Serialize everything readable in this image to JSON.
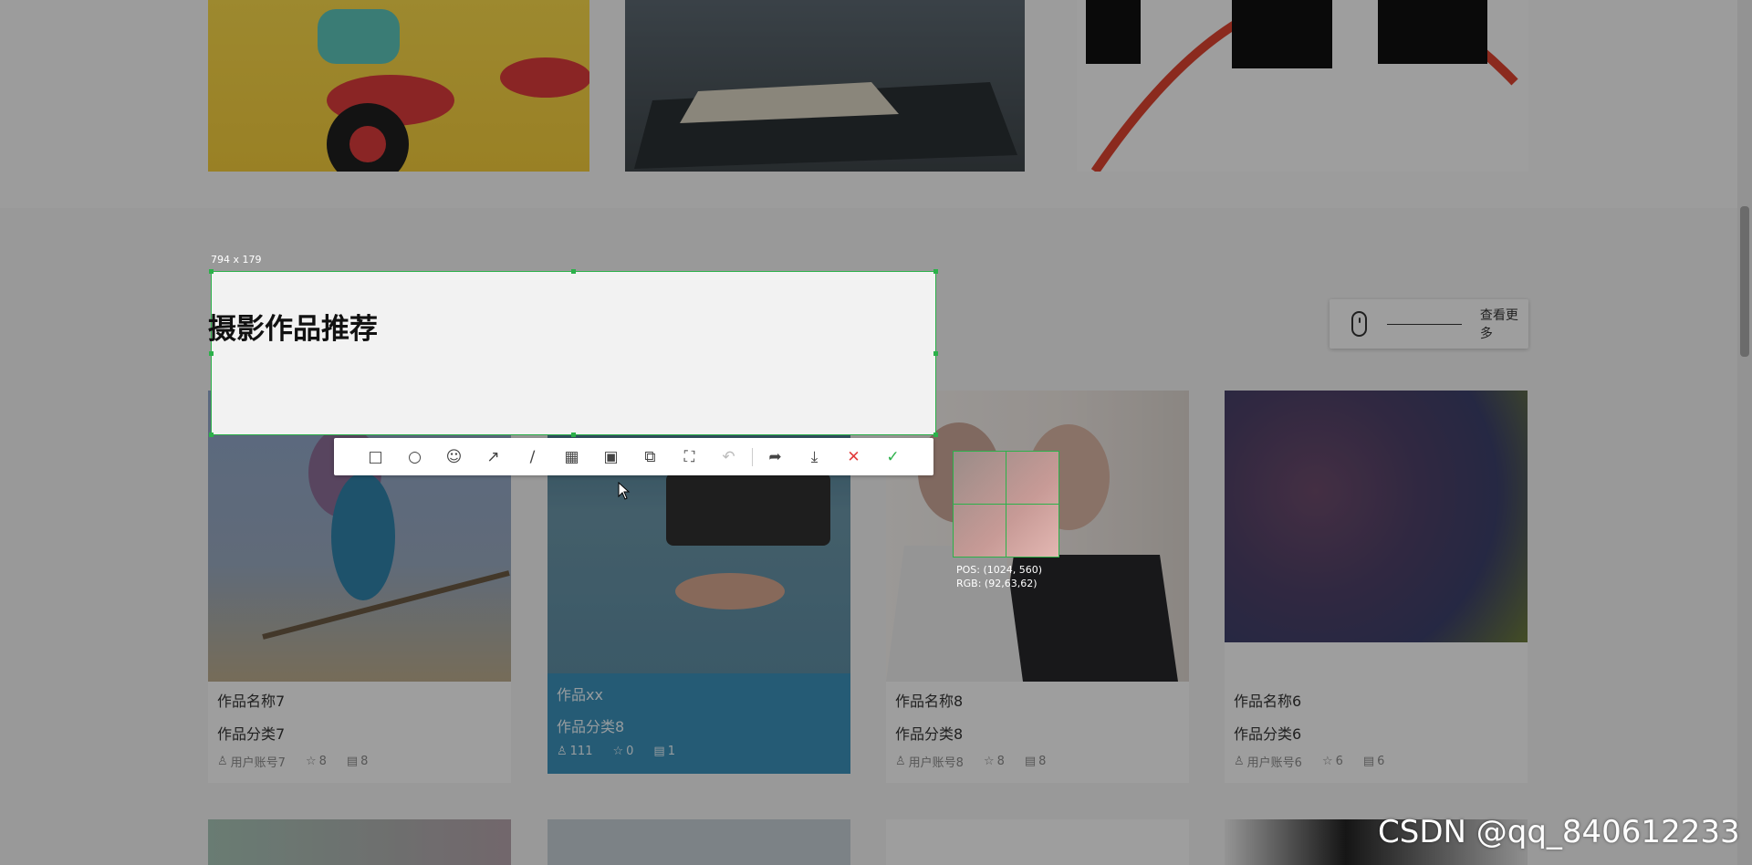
{
  "section": {
    "title": "摄影作品推荐",
    "more_label": "查看更多"
  },
  "cards": [
    {
      "name": "作品名称7",
      "category": "作品分类7",
      "user": "用户账号7",
      "stars": "8",
      "comments": "8"
    },
    {
      "name": "作品xx",
      "category": "作品分类8",
      "user": "111",
      "stars": "0",
      "comments": "1"
    },
    {
      "name": "作品名称8",
      "category": "作品分类8",
      "user": "用户账号8",
      "stars": "8",
      "comments": "8"
    },
    {
      "name": "作品名称6",
      "category": "作品分类6",
      "user": "用户账号6",
      "stars": "6",
      "comments": "6"
    }
  ],
  "screenshot_tool": {
    "size_label": "794 x 179",
    "pos_label": "POS: (1024, 560)",
    "rgb_label": "RGB: (92,63,62)",
    "tools": [
      "rectangle-icon",
      "ellipse-icon",
      "emoji-icon",
      "arrow-icon",
      "line-icon",
      "mosaic-icon",
      "text-icon",
      "pin-icon",
      "ocr-icon",
      "undo-icon",
      "share-icon",
      "download-icon",
      "cancel-icon",
      "confirm-icon"
    ]
  },
  "watermark": "CSDN @qq_840612233",
  "colors": {
    "selection_border": "#2cb14a",
    "active_card": "#3a8fb7",
    "cancel": "#e23b3b",
    "confirm": "#2cb14a"
  }
}
